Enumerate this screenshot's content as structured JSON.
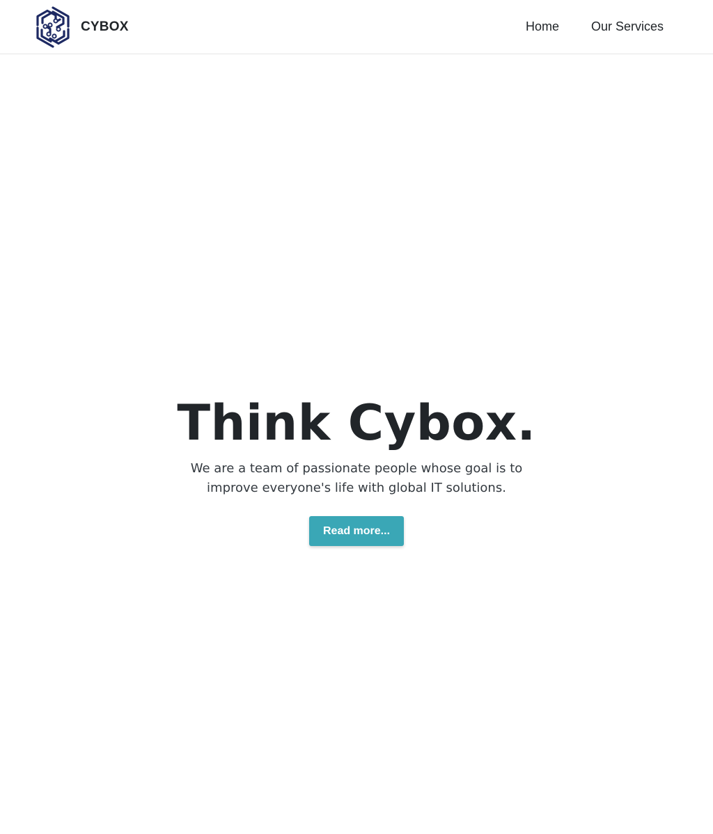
{
  "navbar": {
    "brand_name": "CYBOX",
    "logo_icon": "hexagon-circuit-logo-icon",
    "links": [
      {
        "label": "Home"
      },
      {
        "label": "Our Services"
      }
    ]
  },
  "hero": {
    "title": "Think Cybox.",
    "subtitle": "We are a team of passionate people whose goal is to improve everyone's life with global IT solutions.",
    "button_label": "Read more..."
  },
  "colors": {
    "logo": "#1e2a63",
    "button": "#3aa7b6",
    "text": "#212529"
  }
}
